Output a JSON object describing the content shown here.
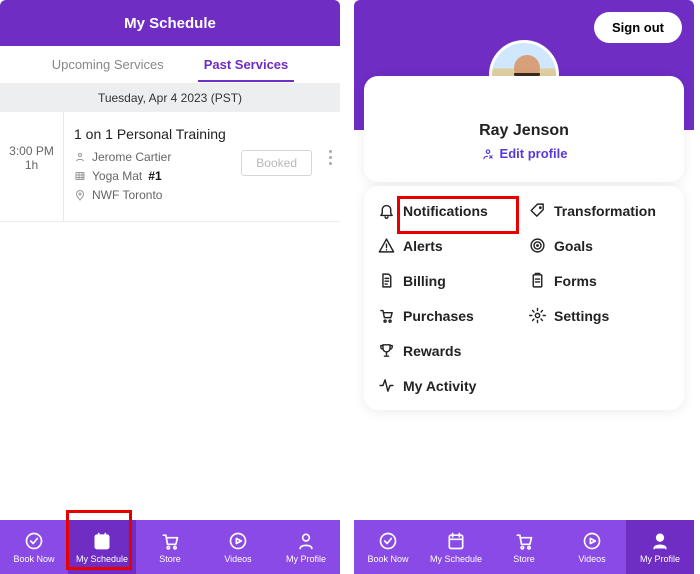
{
  "left": {
    "title": "My Schedule",
    "tabs": {
      "upcoming": "Upcoming Services",
      "past": "Past Services"
    },
    "date": "Tuesday, Apr 4 2023 (PST)",
    "appt": {
      "time": "3:00 PM",
      "duration": "1h",
      "title": "1 on 1 Personal Training",
      "trainer": "Jerome Cartier",
      "equipment": "Yoga Mat ",
      "equipmentNum": "#1",
      "location": "NWF Toronto",
      "status": "Booked"
    }
  },
  "right": {
    "signout": "Sign out",
    "name": "Ray Jenson",
    "edit": "Edit profile",
    "menu": {
      "notifications": "Notifications",
      "transformation": "Transformation",
      "alerts": "Alerts",
      "goals": "Goals",
      "billing": "Billing",
      "forms": "Forms",
      "purchases": "Purchases",
      "settings": "Settings",
      "rewards": "Rewards",
      "activity": "My Activity"
    }
  },
  "nav": {
    "book": "Book Now",
    "schedule": "My Schedule",
    "store": "Store",
    "videos": "Videos",
    "profile": "My Profile"
  }
}
